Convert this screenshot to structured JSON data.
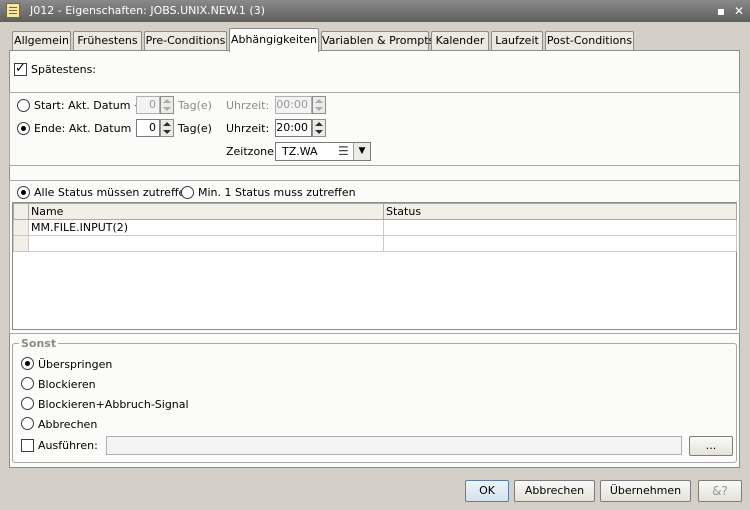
{
  "window": {
    "title": "J012 - Eigenschaften: JOBS.UNIX.NEW.1 (3)",
    "minimize_glyph": "▪",
    "close_glyph": "✕",
    "window_icon": "document-icon"
  },
  "tabs": [
    {
      "label": "Allgemein",
      "active": false
    },
    {
      "label": "Frühestens",
      "active": false
    },
    {
      "label": "Pre-Conditions",
      "active": false
    },
    {
      "label": "Abhängigkeiten",
      "active": true
    },
    {
      "label": "Variablen & Prompts",
      "active": false
    },
    {
      "label": "Kalender",
      "active": false
    },
    {
      "label": "Laufzeit",
      "active": false
    },
    {
      "label": "Post-Conditions",
      "active": false
    }
  ],
  "latest": {
    "checkbox_label": "Spätestens:",
    "checked": true,
    "start": {
      "label": "Start: Akt. Datum +",
      "value": "0",
      "unit": "Tag(e)",
      "time_label": "Uhrzeit:",
      "time_value": "00:00",
      "selected": false
    },
    "end": {
      "label": "Ende: Akt. Datum +",
      "value": "0",
      "unit": "Tag(e)",
      "time_label": "Uhrzeit:",
      "time_value": "20:00",
      "selected": true
    },
    "timezone": {
      "label": "Zeitzone:",
      "value": "TZ.WA"
    }
  },
  "status": {
    "option_all": "Alle Status müssen zutreffen",
    "option_min": "Min. 1 Status muss zutreffen",
    "columns": [
      "Name",
      "Status"
    ],
    "rows": [
      {
        "name": "MM.FILE.INPUT(2)",
        "status": ""
      },
      {
        "name": "",
        "status": ""
      }
    ]
  },
  "other": {
    "title": "Sonst",
    "options": [
      "Überspringen",
      "Blockieren",
      "Blockieren+Abbruch-Signal",
      "Abbrechen"
    ],
    "selected": "Überspringen",
    "execute_label": "Ausführen:",
    "execute_value": "",
    "browse_label": "..."
  },
  "buttons": {
    "ok": "OK",
    "cancel": "Abbrechen",
    "apply": "Übernehmen",
    "help_icon": "help-icon"
  }
}
